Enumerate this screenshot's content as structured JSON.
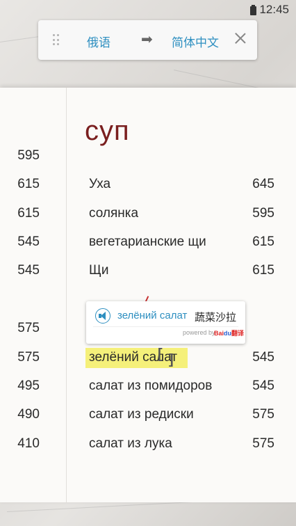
{
  "status_bar": {
    "time": "12:45"
  },
  "translate_bar": {
    "source_language": "俄语",
    "target_language": "简体中文",
    "arrow": "➡"
  },
  "menu": {
    "section_title": "суп",
    "left_prices": [
      "595",
      "615",
      "615",
      "545",
      "545",
      "575",
      "575",
      "495",
      "490",
      "410"
    ],
    "dishes": [
      {
        "name": "Уха",
        "price": "645"
      },
      {
        "name": "солянка",
        "price": "595"
      },
      {
        "name": "вегетарианские щи",
        "price": "615"
      },
      {
        "name": "Щи",
        "price": "615"
      },
      {
        "name": "зелёний салат",
        "price": "545"
      },
      {
        "name": "салат из помидоров",
        "price": "545"
      },
      {
        "name": "салат из редиски",
        "price": "575"
      },
      {
        "name": "салат из лука",
        "price": "575"
      }
    ]
  },
  "popup": {
    "source_text": "зелёний салат",
    "translation": "蔬菜沙拉",
    "powered_by": "powered by",
    "logo_text": "Bai du 翻译"
  },
  "colors": {
    "accent": "#2e8fc0",
    "title": "#7a1f1f",
    "highlight": "#f5f07a"
  }
}
